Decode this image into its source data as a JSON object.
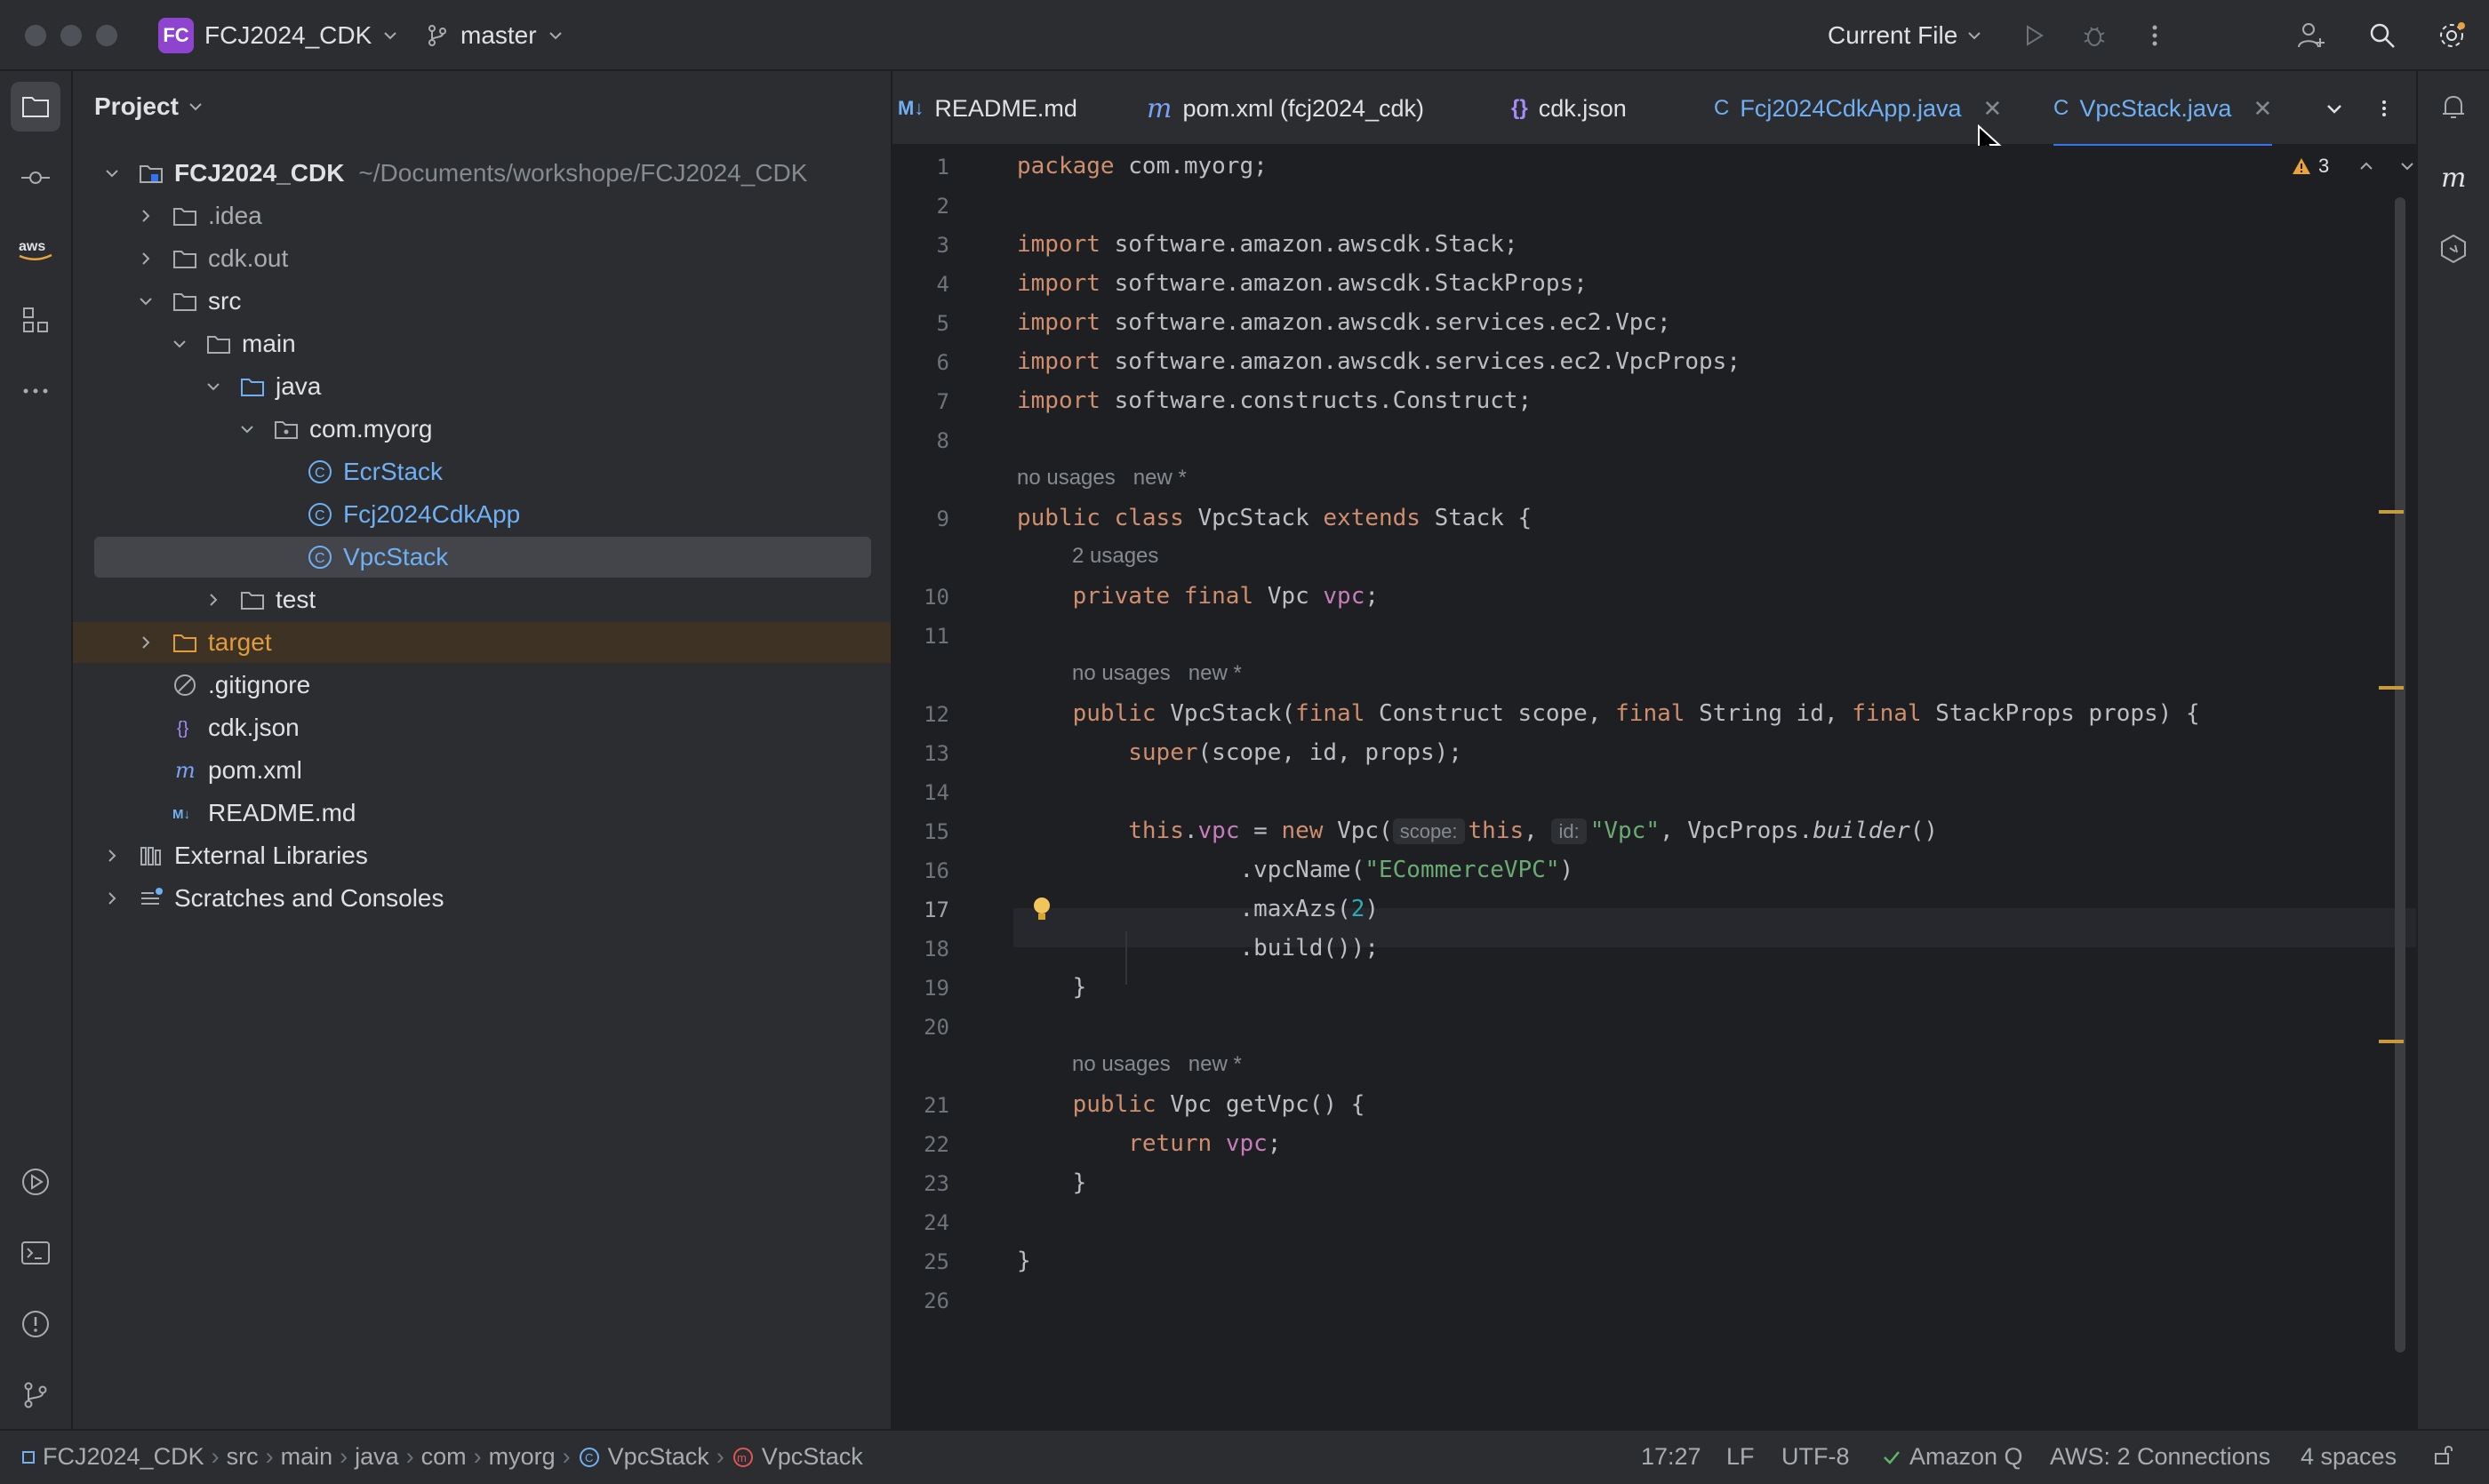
{
  "titlebar": {
    "project_badge": "FC",
    "project_name": "FCJ2024_CDK",
    "branch": "master",
    "run_config": "Current File"
  },
  "project_panel": {
    "header": "Project",
    "root_name": "FCJ2024_CDK",
    "root_path": "~/Documents/workshope/FCJ2024_CDK",
    "items": [
      {
        "label": ".idea"
      },
      {
        "label": "cdk.out"
      },
      {
        "label": "src"
      },
      {
        "label": "main"
      },
      {
        "label": "java"
      },
      {
        "label": "com.myorg"
      },
      {
        "label": "EcrStack"
      },
      {
        "label": "Fcj2024CdkApp"
      },
      {
        "label": "VpcStack"
      },
      {
        "label": "test"
      },
      {
        "label": "target"
      },
      {
        "label": ".gitignore"
      },
      {
        "label": "cdk.json"
      },
      {
        "label": "pom.xml"
      },
      {
        "label": "README.md"
      },
      {
        "label": "External Libraries"
      },
      {
        "label": "Scratches and Consoles"
      }
    ]
  },
  "tabs": [
    {
      "icon": "M↓",
      "label": "README.md"
    },
    {
      "icon": "m",
      "label": "pom.xml (fcj2024_cdk)"
    },
    {
      "icon": "{}",
      "label": "cdk.json"
    },
    {
      "icon": "C",
      "label": "Fcj2024CdkApp.java"
    },
    {
      "icon": "C",
      "label": "VpcStack.java"
    }
  ],
  "editor": {
    "warning_count": "3",
    "hints": {
      "no_usages": "no usages",
      "new": "new *",
      "two_usages": "2 usages"
    },
    "inlay": {
      "scope": "scope:",
      "id": "id:"
    },
    "lines": {
      "l1": "package com.myorg;",
      "l3": "software.amazon.awscdk.Stack;",
      "l4": "software.amazon.awscdk.StackProps;",
      "l5": "software.amazon.awscdk.services.ec2.Vpc;",
      "l6": "software.amazon.awscdk.services.ec2.VpcProps;",
      "l7": "software.constructs.Construct;",
      "l15_str": "\"Vpc\"",
      "l16_str": "\"ECommerceVPC\"",
      "l17_num": "2"
    }
  },
  "statusbar": {
    "breadcrumbs": [
      "FCJ2024_CDK",
      "src",
      "main",
      "java",
      "com",
      "myorg",
      "VpcStack",
      "VpcStack"
    ],
    "position": "17:27",
    "line_sep": "LF",
    "encoding": "UTF-8",
    "amazon_q": "Amazon Q",
    "aws": "AWS: 2 Connections",
    "indent": "4 spaces"
  },
  "colors": {
    "accent": "#3574f0",
    "badge": "#8e44cf",
    "keyword": "#cf8e6d",
    "string": "#6aab73",
    "excluded_folder": "#e09b3c"
  }
}
